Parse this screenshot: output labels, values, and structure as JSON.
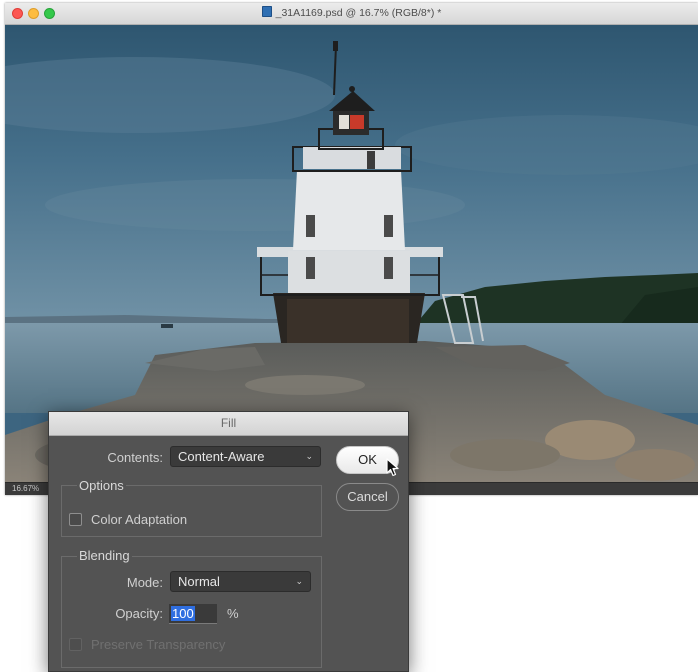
{
  "window": {
    "title": "_31A1169.psd @ 16.7% (RGB/8*) *",
    "zoom_readout": "16.67%"
  },
  "dialog": {
    "title": "Fill",
    "contents_label": "Contents:",
    "contents_value": "Content-Aware",
    "options_group": "Options",
    "color_adaptation_label": "Color Adaptation",
    "color_adaptation_checked": false,
    "blending_group": "Blending",
    "mode_label": "Mode:",
    "mode_value": "Normal",
    "opacity_label": "Opacity:",
    "opacity_value": "100",
    "opacity_unit": "%",
    "preserve_transparency_label": "Preserve Transparency",
    "preserve_transparency_checked": false,
    "ok_label": "OK",
    "cancel_label": "Cancel"
  },
  "icons": {
    "window_close": "close-icon",
    "window_minimize": "minimize-icon",
    "window_maximize": "maximize-icon",
    "file": "psd-file-icon",
    "dropdown": "chevron-down-icon",
    "cursor": "mouse-pointer-icon"
  },
  "colors": {
    "dialog_bg": "#535353",
    "selection_highlight": "#2f6ee0",
    "close": "#fc5753",
    "minimize": "#fdbc40",
    "maximize": "#34c84a"
  }
}
